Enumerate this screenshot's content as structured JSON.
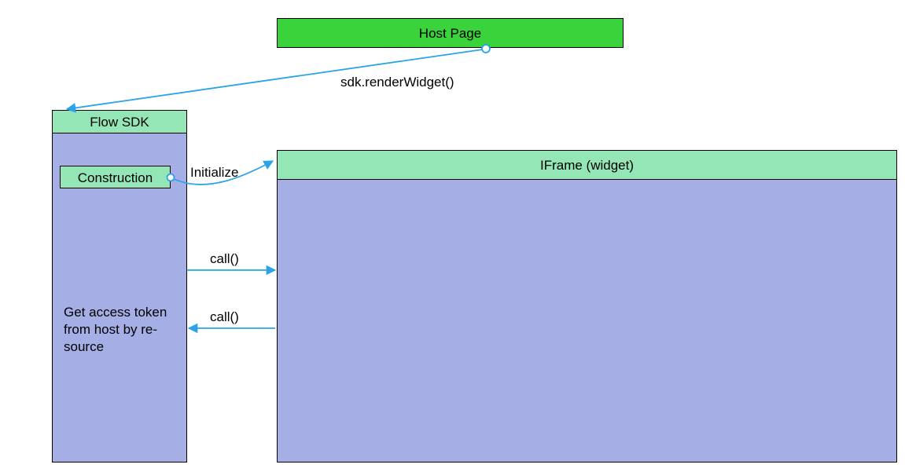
{
  "host": {
    "title": "Host Page"
  },
  "sdk": {
    "title": "Flow SDK",
    "construction_label": "Construction",
    "note": "Get access token from host by re-source"
  },
  "iframe": {
    "title": "IFrame (widget)"
  },
  "arrows": {
    "render_label": "sdk.renderWidget()",
    "initialize_label": "Initialize",
    "call_to_iframe_label": "call()",
    "call_to_sdk_label": "call()"
  },
  "colors": {
    "host_green": "#3BD33B",
    "header_mint": "#94E6B7",
    "body_lavender": "#A5AEE5",
    "arrow_blue": "#2AA4E7"
  }
}
